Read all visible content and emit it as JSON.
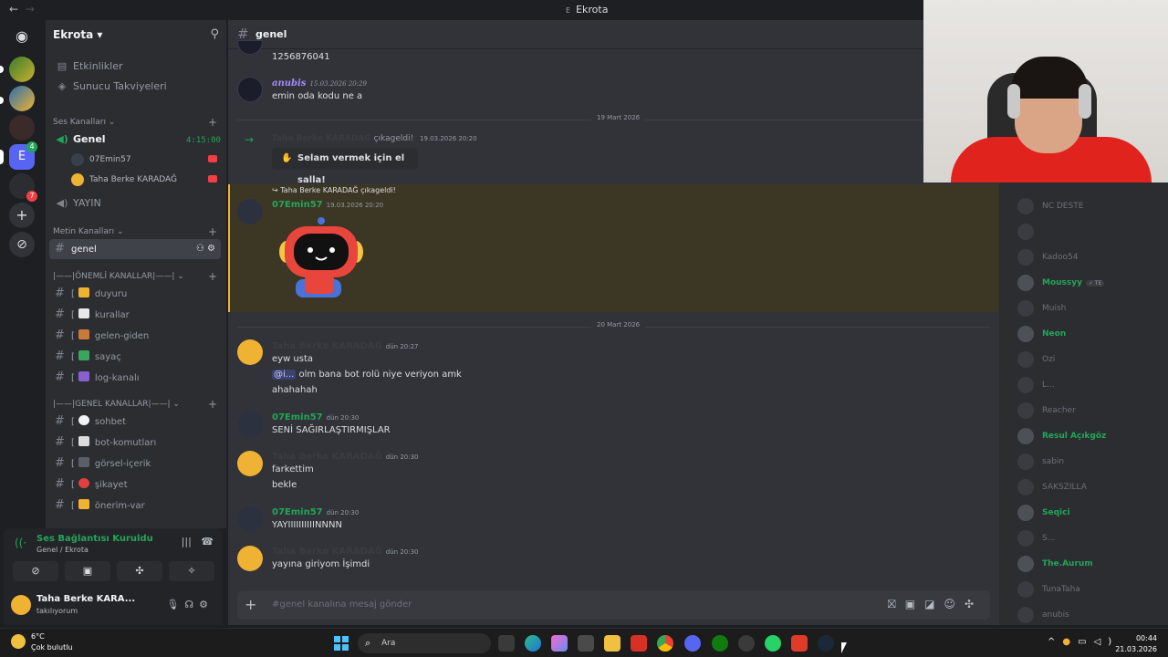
{
  "window": {
    "title": "Ekrota",
    "back": "←",
    "forward": "→"
  },
  "guild": {
    "name": "Ekrota ▾"
  },
  "sidebar": {
    "top_items": [
      {
        "label": "Etkinlikler"
      },
      {
        "label": "Sunucu Takviyeleri"
      }
    ],
    "voice_category": "Ses Kanalları ⌄",
    "voice_channel": {
      "label": "Genel",
      "timer": "4:15:00"
    },
    "voice_users": [
      "07Emin57",
      "Taha Berke KARADAĞ"
    ],
    "yayin": "YAYIN",
    "text_category": "Metin Kanalları ⌄",
    "active_channel": "genel",
    "important_category": "|——|ÖNEMLİ KANALLAR|——|  ⌄",
    "important_channels": [
      "duyuru",
      "kurallar",
      "gelen-giden",
      "sayaç",
      "log-kanalı"
    ],
    "general_category": "|——|GENEL KANALLAR|——|  ⌄",
    "general_channels": [
      "sohbet",
      "bot-komutları",
      "görsel-içerik",
      "şikayet",
      "önerim-var"
    ]
  },
  "voice_panel": {
    "status": "Ses Bağlantısı Kuruldu",
    "sub": "Genel / Ekrota"
  },
  "user": {
    "name": "Taha Berke KARA...",
    "status": "takılıyorum"
  },
  "chat": {
    "channel": "genel",
    "m1_text": "1256876041",
    "m2_author": "anubis",
    "m2_ts": "15.03.2026 20:29",
    "m2_text": "emin oda kodu ne a",
    "sep1": "19 Mart 2026",
    "join1_user": "Taha Berke KARADAĞ",
    "join1_text": "çıkageldi!",
    "join1_ts": "19.03.2026 20:20",
    "wave_label": "Selam vermek için el salla!",
    "reply_ref": "↪ Taha Berke KARADAĞ çıkageldi!",
    "m3_author": "07Emin57",
    "m3_ts": "19.03.2026 20:20",
    "sep2": "20 Mart 2026",
    "m4_author": "Taha Berke KARADAĞ",
    "m4_ts": "dün 20:27",
    "m4_l1": "eyw usta",
    "m4_mention": "@i...",
    "m4_l2": " olm bana bot rolü niye veriyon amk",
    "m4_l3": "ahahahah",
    "m5_author": "07Emin57",
    "m5_ts": "dün 20:30",
    "m5_text": "SENİ SAĞIRLAŞTIRMIŞLAR",
    "m6_author": "Taha Berke KARADAĞ",
    "m6_ts": "dün 20:30",
    "m6_l1": "farkettim",
    "m6_l2": "bekle",
    "m7_author": "07Emin57",
    "m7_ts": "dün 20:30",
    "m7_text": "YAYIIIIIIIIIINNNN",
    "m8_author": "Taha Berke KARADAĞ",
    "m8_ts": "dün 20:30",
    "m8_text": "yayına giriyom İşimdi",
    "composer_placeholder": "#genel kanalına mesaj gönder"
  },
  "members": [
    {
      "name": "NC DESTE",
      "color": "#6d6f78"
    },
    {
      "name": "",
      "color": "#6d6f78"
    },
    {
      "name": "Kadoo54",
      "color": "#6d6f78"
    },
    {
      "name": "Moussyy",
      "color": "#23a559",
      "tag": "✓ TE"
    },
    {
      "name": "Muish",
      "color": "#6d6f78"
    },
    {
      "name": "Neon",
      "color": "#23a559"
    },
    {
      "name": "Ozi",
      "color": "#6d6f78"
    },
    {
      "name": "L...",
      "color": "#6d6f78"
    },
    {
      "name": "Reacher",
      "color": "#6d6f78"
    },
    {
      "name": "Resul Açıkgöz",
      "color": "#23a559"
    },
    {
      "name": "sabin",
      "color": "#6d6f78"
    },
    {
      "name": "SAKSZILLA",
      "color": "#6d6f78"
    },
    {
      "name": "Seqici",
      "color": "#23a559"
    },
    {
      "name": "S...",
      "color": "#6d6f78"
    },
    {
      "name": "The.Aurum",
      "color": "#23a559"
    },
    {
      "name": "TunaTaha",
      "color": "#6d6f78"
    },
    {
      "name": "anubis",
      "color": "#6d6f78"
    }
  ],
  "taskbar": {
    "temp": "6°C",
    "weather": "Çok bulutlu",
    "search": "Ara",
    "time": "00:44",
    "date": "21.03.2026"
  },
  "colors": {
    "accent_green": "#23a559",
    "highlight": "#f0b232",
    "bg_main": "#313338"
  }
}
